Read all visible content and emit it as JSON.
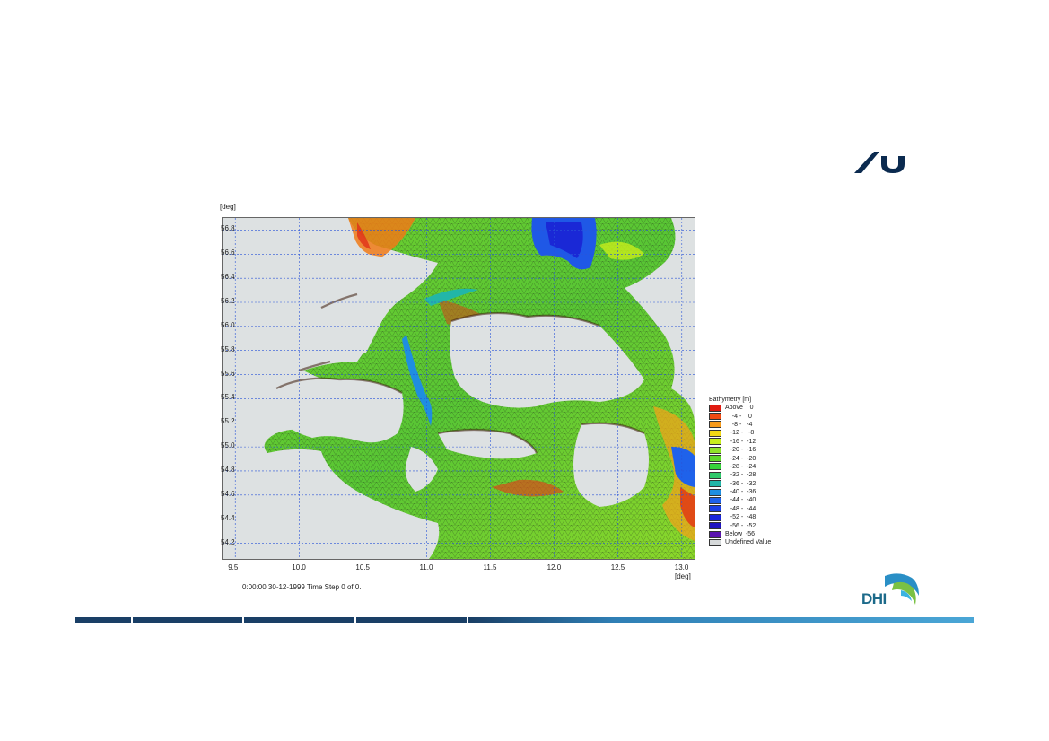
{
  "slide": {
    "caption": "0:00:00 30-12-1999  Time Step 0 of 0.",
    "axes": {
      "y_unit": "[deg]",
      "x_unit": "[deg]",
      "y_ticks": [
        "56.8",
        "56.6",
        "56.4",
        "56.2",
        "56.0",
        "55.8",
        "55.6",
        "55.4",
        "55.2",
        "55.0",
        "54.8",
        "54.6",
        "54.4",
        "54.2"
      ],
      "x_ticks": [
        "9.5",
        "10.0",
        "10.5",
        "11.0",
        "11.5",
        "12.0",
        "12.5",
        "13.0"
      ],
      "x_range": [
        9.4,
        13.1
      ],
      "y_range": [
        54.07,
        56.9
      ]
    },
    "legend": {
      "title": "Bathymetry [m]",
      "items": [
        {
          "label": "Above    0",
          "color": "#e01a10"
        },
        {
          "label": "    -4 -    0",
          "color": "#f24a12"
        },
        {
          "label": "    -8 -   -4",
          "color": "#f79a1a"
        },
        {
          "label": "   -12 -   -8",
          "color": "#f2d814"
        },
        {
          "label": "   -16 -  -12",
          "color": "#c8ee1c"
        },
        {
          "label": "   -20 -  -16",
          "color": "#8fe22a"
        },
        {
          "label": "   -24 -  -20",
          "color": "#5fd82a"
        },
        {
          "label": "   -28 -  -24",
          "color": "#36d23a"
        },
        {
          "label": "   -32 -  -28",
          "color": "#2ec86a"
        },
        {
          "label": "   -36 -  -32",
          "color": "#22b6a8"
        },
        {
          "label": "   -40 -  -36",
          "color": "#1f8ee0"
        },
        {
          "label": "   -44 -  -40",
          "color": "#1f62ea"
        },
        {
          "label": "   -48 -  -44",
          "color": "#1c40e6"
        },
        {
          "label": "   -52 -  -48",
          "color": "#1a26da"
        },
        {
          "label": "   -56 -  -52",
          "color": "#2014c0"
        },
        {
          "label": "Below  -56",
          "color": "#5a12b0"
        },
        {
          "label": "Undefined Value",
          "color": "#d6d9da"
        }
      ]
    },
    "logos": {
      "dhi": "DHI",
      "au": "au-university-logo"
    },
    "colors": {
      "land": "#dde1e2",
      "grid": "#2a54d8",
      "footer_dark": "#1a3f66",
      "footer_light": "#4aa6d6"
    }
  }
}
